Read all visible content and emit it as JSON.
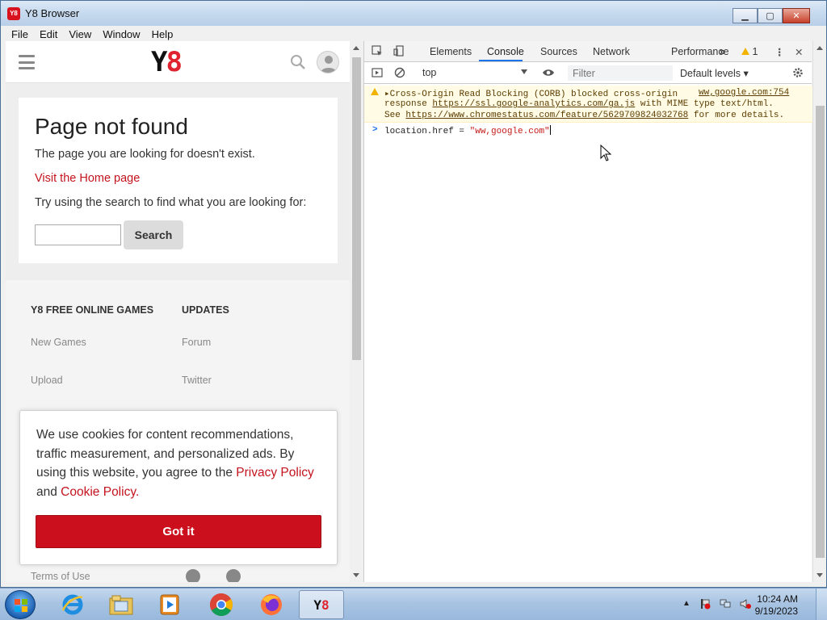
{
  "window": {
    "title": "Y8 Browser",
    "controls": {
      "minimize": "▁",
      "maximize": "▢",
      "close": "✕"
    }
  },
  "menubar": {
    "items": [
      "File",
      "Edit",
      "View",
      "Window",
      "Help"
    ]
  },
  "site": {
    "logo_y": "Y",
    "logo_8": "8",
    "not_found": {
      "title": "Page not found",
      "message": "The page you are looking for doesn't exist.",
      "home_link": "Visit the Home page",
      "search_hint": "Try using the search to find what you are looking for:",
      "search_value": "",
      "search_button": "Search"
    },
    "footer": {
      "col1_title": "Y8 FREE ONLINE GAMES",
      "col1_links": [
        "New Games",
        "Upload"
      ],
      "col2_title": "UPDATES",
      "col2_links": [
        "Forum",
        "Twitter"
      ],
      "bottom_link": "Terms of Use"
    },
    "cookie": {
      "text_before": "We use cookies for content recommendations, traffic measurement, and personalized ads. By using this website, you agree to the ",
      "privacy_link": "Privacy Policy",
      "and": " and ",
      "cookie_link": "Cookie Policy",
      "period": ".",
      "button": "Got it"
    }
  },
  "devtools": {
    "tabs": [
      "Elements",
      "Console",
      "Sources",
      "Network",
      "Performance"
    ],
    "active_tab": "Console",
    "more_tabs": "»",
    "warning_count": "1",
    "toolbar": {
      "context": "top",
      "filter_placeholder": "Filter",
      "levels": "Default levels ▾"
    },
    "warning": {
      "line1": "Cross-Origin Read Blocking (CORB) blocked cross-origin",
      "line2_pre": "response ",
      "line2_link": "https://ssl.google-analytics.com/ga.js",
      "line2_post": " with MIME type text/html.",
      "line3_pre": "See ",
      "line3_link": "https://www.chromestatus.com/feature/5629709824032768",
      "line3_post": " for more details.",
      "source": "ww,google.com:754"
    },
    "input": {
      "prompt": ">",
      "code_pre": "location.href = ",
      "code_str": "\"ww,google.com\""
    }
  },
  "taskbar": {
    "time": "10:24 AM",
    "date": "9/19/2023",
    "y8_label": "Y8"
  },
  "colors": {
    "accent_red": "#cc0f1c",
    "devtools_blue": "#1a73e8",
    "warning_bg": "#fffbe5"
  }
}
